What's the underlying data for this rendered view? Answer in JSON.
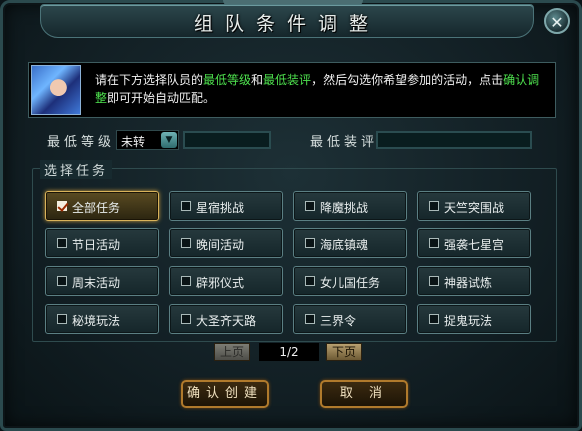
{
  "dialog": {
    "title": "组队条件调整",
    "close_glyph": "✕"
  },
  "info": {
    "text_before": "请在下方选择队员的",
    "highlight1": "最低等级",
    "text_and": "和",
    "highlight2": "最低装评",
    "text_mid": "，然后勾选你希望参加的活动，点击",
    "highlight3": "确认调整",
    "text_after": "即可开始自动匹配。"
  },
  "filters": {
    "min_level_label": "最低等级",
    "min_level_value": "未转",
    "min_score_label": "最低装评"
  },
  "tasks": {
    "group_title": "选择任务",
    "items": [
      {
        "label": "全部任务",
        "checked": true
      },
      {
        "label": "星宿挑战",
        "checked": false
      },
      {
        "label": "降魔挑战",
        "checked": false
      },
      {
        "label": "天竺突围战",
        "checked": false
      },
      {
        "label": "节日活动",
        "checked": false
      },
      {
        "label": "晚间活动",
        "checked": false
      },
      {
        "label": "海底镇魂",
        "checked": false
      },
      {
        "label": "强袭七星宫",
        "checked": false
      },
      {
        "label": "周末活动",
        "checked": false
      },
      {
        "label": "辟邪仪式",
        "checked": false
      },
      {
        "label": "女儿国任务",
        "checked": false
      },
      {
        "label": "神器试炼",
        "checked": false
      },
      {
        "label": "秘境玩法",
        "checked": false
      },
      {
        "label": "大圣齐天路",
        "checked": false
      },
      {
        "label": "三界令",
        "checked": false
      },
      {
        "label": "捉鬼玩法",
        "checked": false
      }
    ]
  },
  "pager": {
    "prev_label": "上页",
    "page": "1/2",
    "next_label": "下页"
  },
  "actions": {
    "confirm_label": "确认创建",
    "cancel_label": "取 消"
  }
}
